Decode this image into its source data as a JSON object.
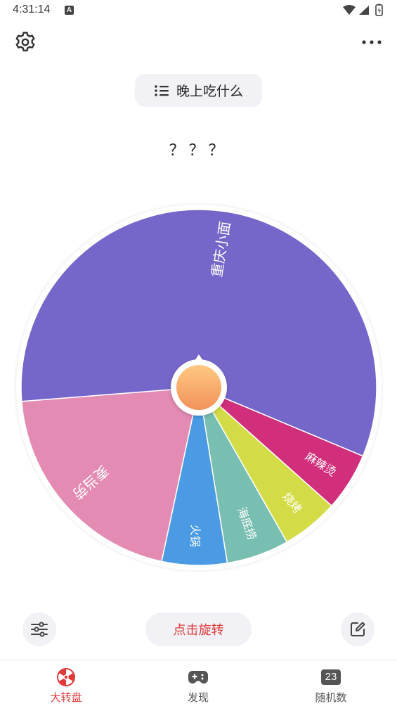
{
  "status": {
    "time": "4:31:14",
    "notification_letter": "A"
  },
  "header": {
    "settings_icon": "gear-icon",
    "more_icon": "more-horizontal-icon"
  },
  "title_pill": {
    "icon": "list-icon",
    "label": "晚上吃什么"
  },
  "result": {
    "text": "？？？"
  },
  "wheel": {
    "segments": [
      {
        "label": "重庆小面",
        "fraction": 0.5755,
        "color": "#7566c9"
      },
      {
        "label": "麻辣烫",
        "fraction": 0.0528,
        "color": "#d12e7b"
      },
      {
        "label": "烧烤",
        "fraction": 0.0517,
        "color": "#d3dc47"
      },
      {
        "label": "海底捞",
        "fraction": 0.0569,
        "color": "#78bfb1"
      },
      {
        "label": "火锅",
        "fraction": 0.0592,
        "color": "#4a9be4"
      },
      {
        "label": "麦当劳",
        "fraction": 0.2039,
        "color": "#e48bb4"
      }
    ],
    "hub_gradient": [
      "#ffc883",
      "#f2925a"
    ]
  },
  "controls": {
    "spin_label": "点击旋转",
    "left_icon": "sliders-icon",
    "right_icon": "edit-icon",
    "accent": "#e03a3a"
  },
  "tabs": [
    {
      "label": "大转盘",
      "icon": "wheel-icon",
      "active": true
    },
    {
      "label": "发现",
      "icon": "gamepad-icon",
      "active": false
    },
    {
      "label": "随机数",
      "icon_text": "23",
      "active": false
    }
  ]
}
